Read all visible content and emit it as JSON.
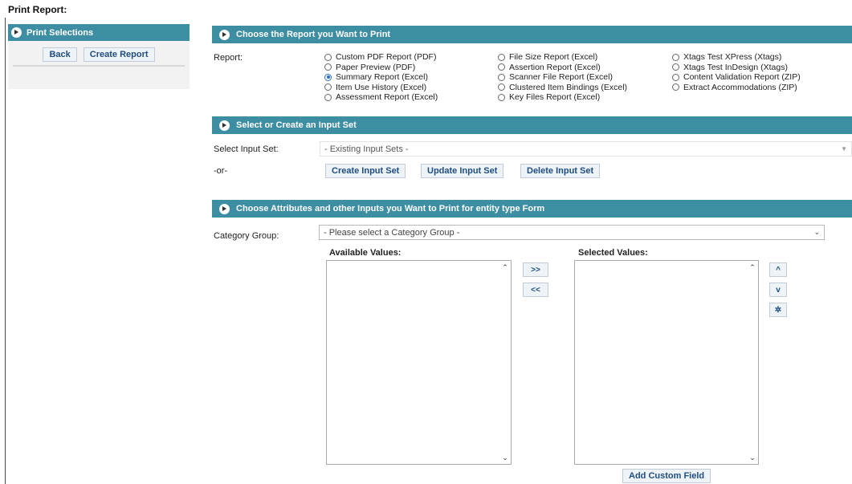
{
  "page": {
    "title": "Print Report:"
  },
  "sidebar": {
    "header": "Print Selections",
    "back_label": "Back",
    "create_report_label": "Create Report"
  },
  "report_section": {
    "header": "Choose the Report you Want to Print",
    "report_label": "Report:",
    "columns": [
      [
        "Custom PDF Report (PDF)",
        "Paper Preview (PDF)",
        "Summary Report (Excel)",
        "Item Use History (Excel)",
        "Assessment Report (Excel)"
      ],
      [
        "File Size Report (Excel)",
        "Assertion Report (Excel)",
        "Scanner File Report (Excel)",
        "Clustered Item Bindings (Excel)",
        "Key Files Report (Excel)"
      ],
      [
        "Xtags Test XPress (Xtags)",
        "Xtags Test InDesign (Xtags)",
        "Content Validation Report (ZIP)",
        "Extract Accommodations (ZIP)"
      ]
    ],
    "selected": "Summary Report (Excel)"
  },
  "input_set_section": {
    "header": "Select or Create an Input Set",
    "select_label": "Select Input Set:",
    "select_value": "- Existing Input Sets -",
    "or_label": "-or-",
    "create_label": "Create Input Set",
    "update_label": "Update Input Set",
    "delete_label": "Delete Input Set"
  },
  "attributes_section": {
    "header": "Choose Attributes and other Inputs you Want to Print for entity type Form",
    "category_label": "Category Group:",
    "category_value": "- Please select a Category Group -",
    "available_label": "Available Values:",
    "selected_label": "Selected Values:",
    "move_right_label": ">>",
    "move_left_label": "<<",
    "move_up_label": "^",
    "move_down_label": "v",
    "remove_label": "✲",
    "add_custom_field_label": "Add Custom Field"
  },
  "colors": {
    "header_bg": "#3d8ea3",
    "radio_checked": "#2a6bd1",
    "button_text": "#1f4d80"
  }
}
